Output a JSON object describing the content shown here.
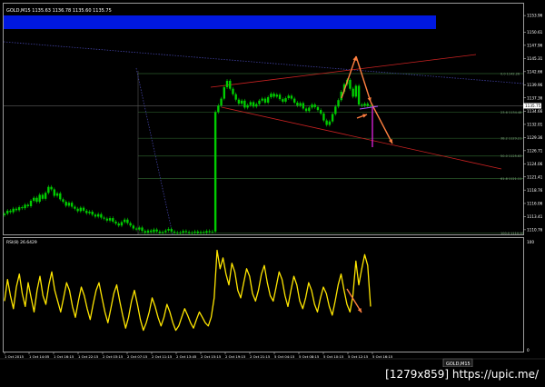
{
  "title": "GOLD,M15  1135.63 1136.78 1135.60 1135.75",
  "rsi_title": "RSI(8) 26.6429",
  "watermark": "[1279x859] https://upic.me/",
  "tab_label": "GOLD,M15",
  "colors": {
    "bg": "#000000",
    "candle": "#00cc00",
    "rsi": "#ffe600",
    "arrow": "#ff8040",
    "channel": "#cc2222",
    "band": "#0018e0",
    "dotted": "#4040a0"
  },
  "chart_data": [
    {
      "type": "candlestick",
      "title": "GOLD,M15  1135.63 1136.78 1135.60 1135.75",
      "ylim": [
        1110.0,
        1156.0
      ],
      "y_ticks": [
        "1153.96",
        "1150.61",
        "1147.96",
        "1145.31",
        "1142.66",
        "1139.96",
        "1137.36",
        "1134.66",
        "1132.01",
        "1129.36",
        "1126.71",
        "1124.06",
        "1121.41",
        "1118.76",
        "1116.06",
        "1113.41",
        "1110.76"
      ],
      "current_price": "1135.75",
      "fib_levels": [
        "0.0 1142.26",
        "23.6 1134.48",
        "38.2 1129.21",
        "50.0 1125.63",
        "61.8 1121.11",
        "100.0 1110.10"
      ],
      "x_ticks": [
        "1 Oct 2015",
        "1 Oct 14:05",
        "1 Oct 16:15",
        "1 Oct 22:15",
        "2 Oct 03:15",
        "2 Oct 07:15",
        "2 Oct 11:15",
        "2 Oct 13:45",
        "2 Oct 15:15",
        "2 Oct 19:15",
        "2 Oct 21:15",
        "5 Oct 04:15",
        "5 Oct 08:15",
        "5 Oct 10:15",
        "5 Oct 12:15",
        "5 Oct 16:15"
      ],
      "close": [
        1114.0,
        1114.6,
        1114.3,
        1115.0,
        1114.7,
        1115.3,
        1115.1,
        1115.8,
        1115.5,
        1116.6,
        1117.2,
        1116.4,
        1117.8,
        1117.0,
        1118.2,
        1119.4,
        1118.9,
        1117.6,
        1118.1,
        1116.9,
        1116.4,
        1115.6,
        1116.2,
        1115.4,
        1115.0,
        1114.5,
        1115.2,
        1114.6,
        1114.1,
        1114.4,
        1113.8,
        1113.4,
        1113.9,
        1113.2,
        1113.0,
        1112.6,
        1113.1,
        1112.4,
        1112.0,
        1111.6,
        1112.3,
        1112.8,
        1112.1,
        1111.6,
        1111.0,
        1110.8,
        1111.2,
        1110.5,
        1110.2,
        1110.6,
        1110.3,
        1110.8,
        1110.4,
        1110.1,
        1110.3,
        1110.6,
        1110.9,
        1110.4,
        1110.2,
        1110.1,
        1110.2,
        1110.5,
        1110.3,
        1110.1,
        1110.2,
        1110.4,
        1110.1,
        1110.3,
        1110.2,
        1110.5,
        1110.3,
        1110.4,
        1134.5,
        1135.8,
        1137.2,
        1139.5,
        1140.8,
        1139.2,
        1138.1,
        1137.0,
        1136.2,
        1136.8,
        1135.4,
        1135.9,
        1136.5,
        1135.6,
        1136.1,
        1136.8,
        1137.2,
        1136.4,
        1137.5,
        1138.2,
        1137.6,
        1138.0,
        1137.1,
        1136.6,
        1137.3,
        1137.8,
        1137.2,
        1136.4,
        1135.8,
        1136.3,
        1135.2,
        1134.7,
        1135.4,
        1136.0,
        1135.5,
        1134.9,
        1134.2,
        1132.8,
        1131.9,
        1132.6,
        1134.1,
        1135.6,
        1136.9,
        1138.6,
        1140.1,
        1141.0,
        1139.2,
        1137.6,
        1139.8,
        1136.0,
        1135.8,
        1136.2,
        1135.7,
        1135.75
      ],
      "rsi": [
        45,
        65,
        50,
        38,
        58,
        70,
        52,
        40,
        62,
        48,
        35,
        55,
        68,
        50,
        42,
        60,
        72,
        55,
        45,
        35,
        48,
        62,
        55,
        40,
        30,
        45,
        58,
        50,
        38,
        28,
        42,
        55,
        62,
        48,
        35,
        25,
        38,
        52,
        60,
        45,
        32,
        20,
        30,
        45,
        55,
        42,
        28,
        18,
        25,
        35,
        48,
        40,
        30,
        22,
        30,
        42,
        35,
        25,
        18,
        22,
        30,
        38,
        32,
        25,
        20,
        28,
        35,
        30,
        25,
        22,
        30,
        48,
        92,
        75,
        85,
        70,
        60,
        80,
        72,
        55,
        48,
        62,
        75,
        68,
        52,
        45,
        55,
        70,
        78,
        62,
        50,
        45,
        58,
        72,
        65,
        50,
        40,
        55,
        68,
        60,
        45,
        38,
        48,
        62,
        55,
        42,
        35,
        48,
        58,
        52,
        40,
        32,
        45,
        60,
        70,
        55,
        42,
        35,
        50,
        82,
        60,
        75,
        88,
        78,
        40
      ]
    }
  ]
}
